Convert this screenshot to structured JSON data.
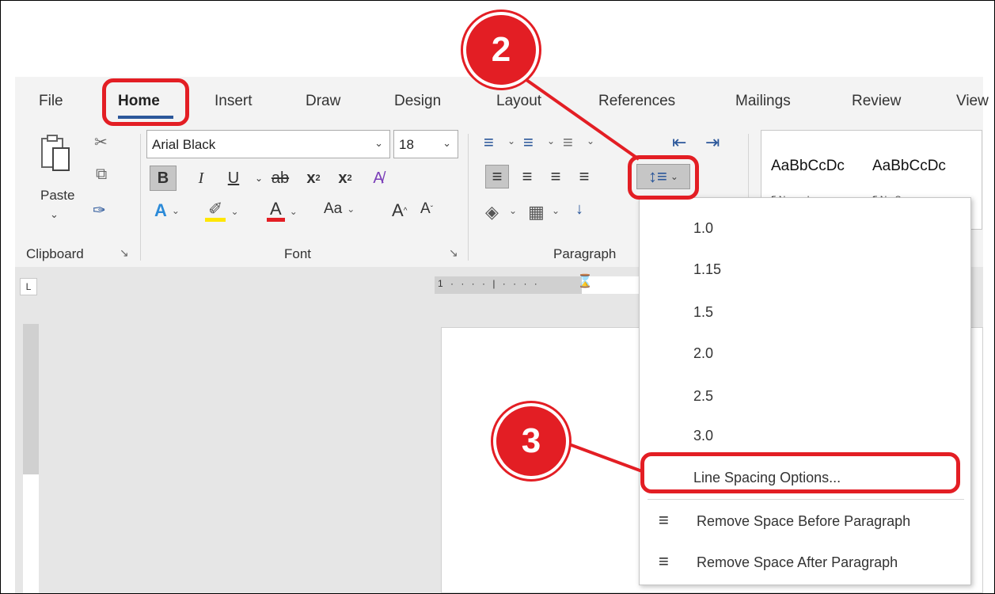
{
  "tabs": [
    "File",
    "Home",
    "Insert",
    "Draw",
    "Design",
    "Layout",
    "References",
    "Mailings",
    "Review",
    "View"
  ],
  "clipboard": {
    "paste_label": "Paste",
    "group_label": "Clipboard"
  },
  "font": {
    "name": "Arial Black",
    "size": "18",
    "group_label": "Font",
    "bold": "B",
    "italic": "I",
    "underline": "U",
    "strike": "ab",
    "subscript": "x",
    "superscript": "x",
    "change_case": "Aa",
    "grow": "A",
    "shrink": "A"
  },
  "paragraph": {
    "group_label": "Paragraph"
  },
  "styles": {
    "item1": "AaBbCcDc",
    "item2": "AaBbCcDc",
    "sub1": "¶ Normal",
    "sub2": "¶ No Spac..."
  },
  "ruler": {
    "corner": "L",
    "h_text": "1 · · · · | · · · ·"
  },
  "line_spacing_menu": {
    "options": [
      "1.0",
      "1.15",
      "1.5",
      "2.0",
      "2.5",
      "3.0"
    ],
    "options_label": "Line Spacing Options...",
    "remove_before": "Remove Space Before Paragraph",
    "remove_after": "Remove Space After Paragraph"
  },
  "annotations": {
    "step2": "2",
    "step3": "3"
  },
  "colors": {
    "accent": "#2b579a",
    "annotation": "#e31e24",
    "ribbon_bg": "#f3f3f3"
  }
}
